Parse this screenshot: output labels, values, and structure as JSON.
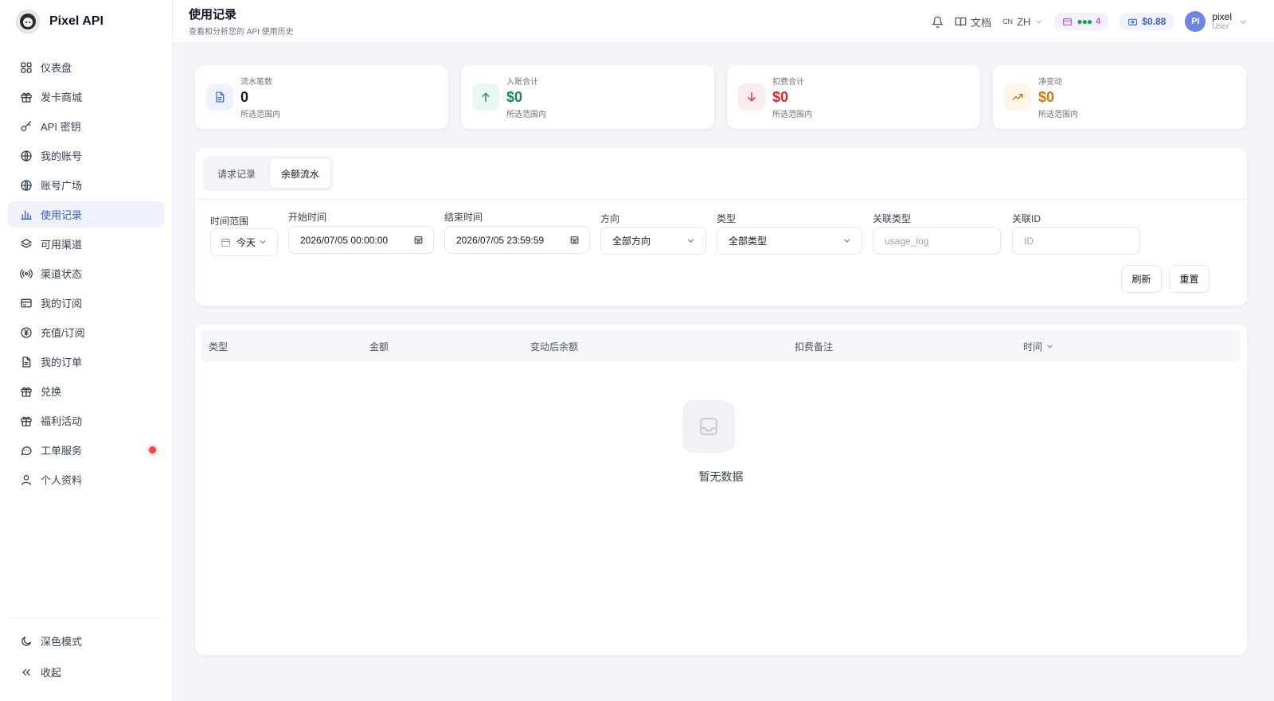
{
  "brand": {
    "name": "Pixel API"
  },
  "sidebar": {
    "items": [
      {
        "label": "仪表盘",
        "icon": "dashboard-icon",
        "active": false
      },
      {
        "label": "发卡商城",
        "icon": "gift-icon",
        "active": false
      },
      {
        "label": "API 密钥",
        "icon": "key-icon",
        "active": false
      },
      {
        "label": "我的账号",
        "icon": "globe-icon",
        "active": false
      },
      {
        "label": "账号广场",
        "icon": "globe-icon",
        "active": false
      },
      {
        "label": "使用记录",
        "icon": "bar-chart-icon",
        "active": true
      },
      {
        "label": "可用渠道",
        "icon": "layers-icon",
        "active": false
      },
      {
        "label": "渠道状态",
        "icon": "broadcast-icon",
        "active": false
      },
      {
        "label": "我的订阅",
        "icon": "credit-card-icon",
        "active": false
      },
      {
        "label": "充值/订阅",
        "icon": "yen-coin-icon",
        "active": false
      },
      {
        "label": "我的订单",
        "icon": "document-icon",
        "active": false
      },
      {
        "label": "兑换",
        "icon": "gift-icon",
        "active": false
      },
      {
        "label": "福利活动",
        "icon": "gift-icon",
        "active": false
      },
      {
        "label": "工单服务",
        "icon": "chat-bubble-icon",
        "active": false,
        "badge_dot": true
      },
      {
        "label": "个人资料",
        "icon": "user-icon",
        "active": false
      }
    ],
    "bottom": [
      {
        "label": "深色模式",
        "icon": "moon-icon"
      },
      {
        "label": "收起",
        "icon": "double-chevron-left-icon"
      }
    ]
  },
  "header": {
    "title": "使用记录",
    "subtitle": "查看和分析您的 API 使用历史",
    "docs_label": "文档",
    "lang_flag": "CN",
    "lang_label": "ZH",
    "status_count": "4",
    "balance": "$0.88",
    "avatar_initials": "PI",
    "user_name": "pixel",
    "user_role": "User"
  },
  "stats": [
    {
      "label": "流水笔数",
      "value": "0",
      "hint": "所选范围内",
      "icon": "file-icon",
      "color": "#111827",
      "icon_bg": "#eef2ff",
      "icon_color": "#4f6bdc"
    },
    {
      "label": "入账合计",
      "value": "$0",
      "hint": "所选范围内",
      "icon": "arrow-up-icon",
      "color": "#0f8a5f",
      "icon_bg": "#e9f8f1",
      "icon_color": "#0f8a5f"
    },
    {
      "label": "扣费合计",
      "value": "$0",
      "hint": "所选范围内",
      "icon": "arrow-down-icon",
      "color": "#dc2626",
      "icon_bg": "#fdecee",
      "icon_color": "#dc2626"
    },
    {
      "label": "净变动",
      "value": "$0",
      "hint": "所选范围内",
      "icon": "trending-up-icon",
      "color": "#d97706",
      "icon_bg": "#fef6e7",
      "icon_color": "#d97706"
    }
  ],
  "tabs": [
    {
      "label": "请求记录",
      "active": false
    },
    {
      "label": "余额流水",
      "active": true
    }
  ],
  "filters": {
    "range_label": "时间范围",
    "range_value": "今天",
    "start_label": "开始时间",
    "start_value": "2026/07/05 00:00:00",
    "end_label": "结束时间",
    "end_value": "2026/07/05 23:59:59",
    "direction_label": "方向",
    "direction_value": "全部方向",
    "type_label": "类型",
    "type_value": "全部类型",
    "ref_type_label": "关联类型",
    "ref_type_placeholder": "usage_log",
    "ref_id_label": "关联ID",
    "ref_id_placeholder": "ID",
    "refresh_label": "刷新",
    "reset_label": "重置"
  },
  "table": {
    "columns": [
      "类型",
      "金额",
      "变动后余额",
      "扣费备注",
      "时间"
    ],
    "empty_text": "暂无数据"
  }
}
